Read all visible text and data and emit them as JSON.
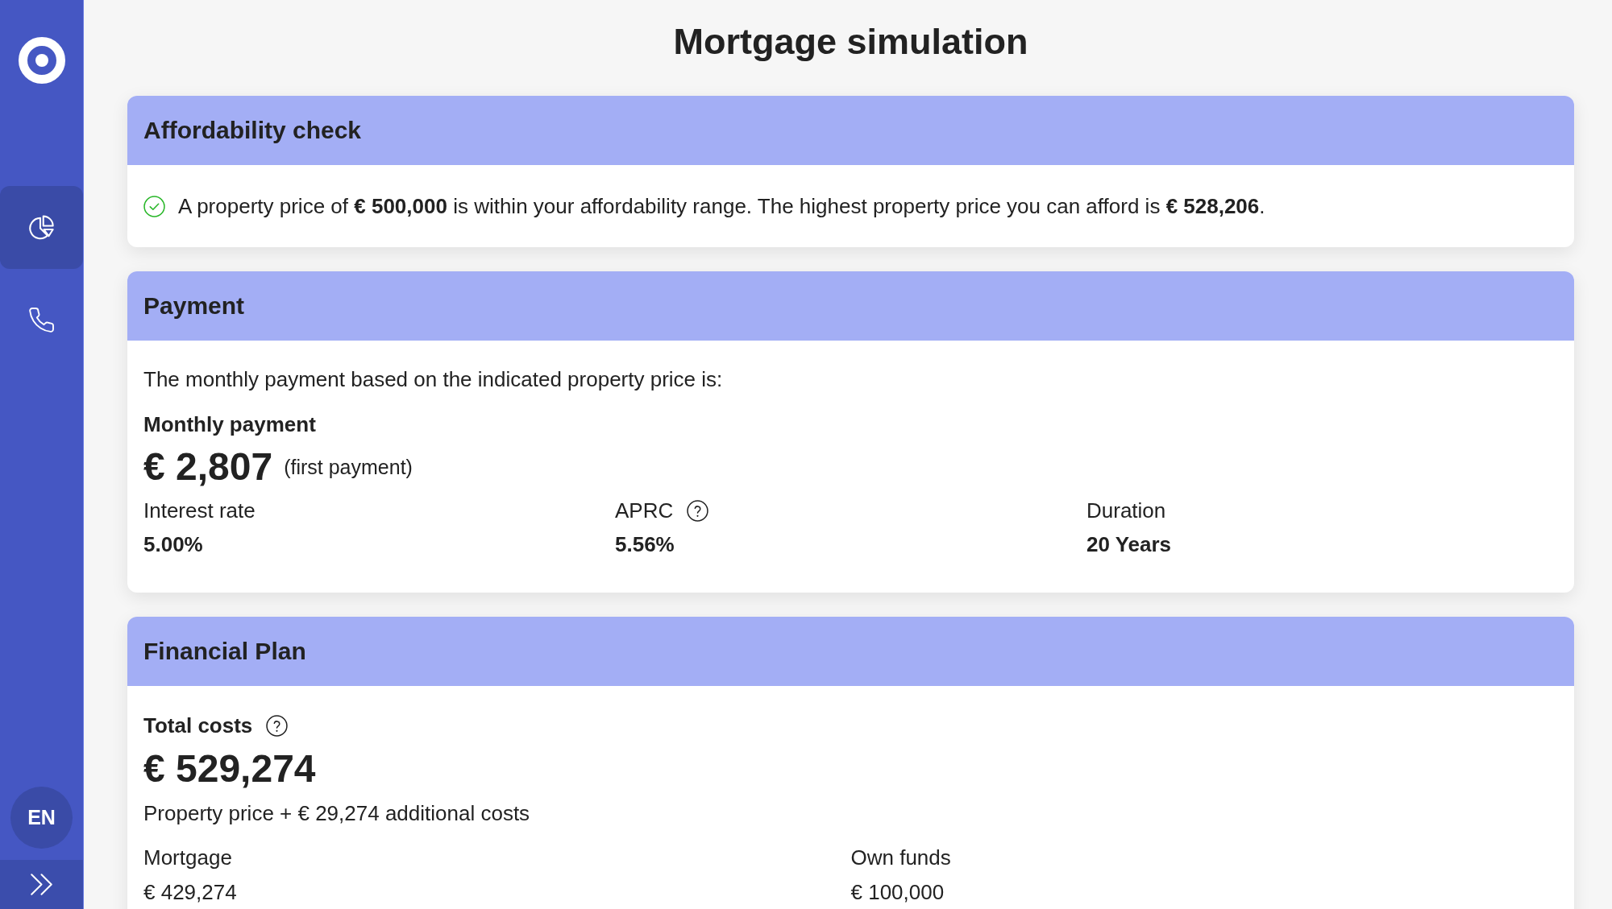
{
  "sidebar": {
    "nav_items": [
      {
        "kind": "chart",
        "selected": true
      },
      {
        "kind": "phone",
        "selected": false
      }
    ],
    "language": "EN"
  },
  "title": "Mortgage simulation",
  "affordability": {
    "title": "Affordability check",
    "within_range": true,
    "message": "A property price of **€ 500,000** is within your affordability range. The highest property price you can afford is **€ 528,206**."
  },
  "payment": {
    "title": "Payment",
    "intro": "The monthly payment based on the indicated property price is:",
    "label": "Monthly payment",
    "amount": "€ 2,807",
    "note": "(first payment)",
    "details": [
      {
        "label": "Interest rate",
        "value": "5.00%",
        "help": false
      },
      {
        "label": "APRC",
        "value": "5.56%",
        "help": true
      },
      {
        "label": "Duration",
        "value": "20 Years",
        "help": false
      }
    ]
  },
  "financial_plan": {
    "title": "Financial Plan",
    "label": "Total costs",
    "help": true,
    "amount": "€ 529,274",
    "breakdown": "Property price + € 29,274 additional costs",
    "details": [
      {
        "label": "Mortgage",
        "value": "€ 429,274"
      },
      {
        "label": "Own funds",
        "value": "€ 100,000"
      }
    ]
  }
}
